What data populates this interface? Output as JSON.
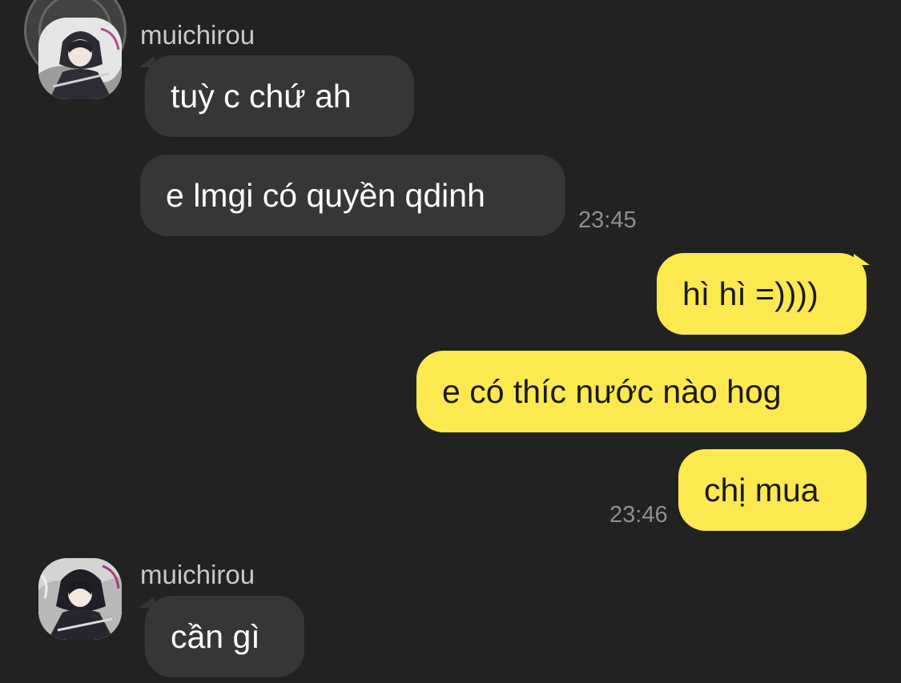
{
  "chat": {
    "messages": [
      {
        "sender": "muichirou",
        "text": "tuỳ c chứ ah"
      },
      {
        "text": "e lmgi có quyền qdinh",
        "time": "23:45"
      },
      {
        "text": "hì hì =))))"
      },
      {
        "text": "e có thíc nước nào hog"
      },
      {
        "text": "chị mua",
        "time": "23:46"
      },
      {
        "sender": "muichirou",
        "text": "cần gì"
      }
    ]
  },
  "colors": {
    "background": "#222222",
    "incoming_bubble": "#363636",
    "outgoing_bubble": "#fbe94f",
    "timestamp": "#8e8e8e",
    "sender_name": "#c9c9c9"
  },
  "icons": {
    "avatar": "avatar-image",
    "touch": "touch-indicator"
  }
}
